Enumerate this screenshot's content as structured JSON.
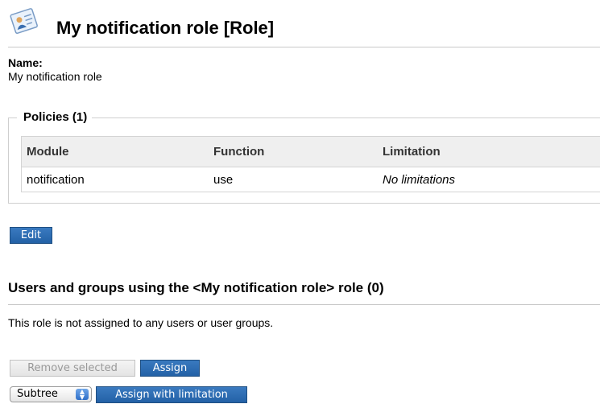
{
  "header": {
    "title": "My notification role [Role]",
    "icon": "role-icon"
  },
  "role": {
    "name_label": "Name:",
    "name_value": "My notification role"
  },
  "policies": {
    "legend": "Policies (1)",
    "columns": [
      "Module",
      "Function",
      "Limitation"
    ],
    "rows": [
      {
        "module": "notification",
        "function": "use",
        "limitation": "No limitations"
      }
    ]
  },
  "buttons": {
    "edit": "Edit",
    "remove_selected": "Remove selected",
    "assign": "Assign",
    "assign_with_limitation": "Assign with limitation"
  },
  "users_section": {
    "title": "Users and groups using the <My notification role> role (0)",
    "empty_message": "This role is not assigned to any users or user groups."
  },
  "limitation_select": {
    "selected": "Subtree"
  },
  "colors": {
    "button_primary": "#2a6bb3",
    "button_disabled": "#e8e8e8",
    "table_header_bg": "#efefef",
    "divider": "#c8c8c8"
  }
}
